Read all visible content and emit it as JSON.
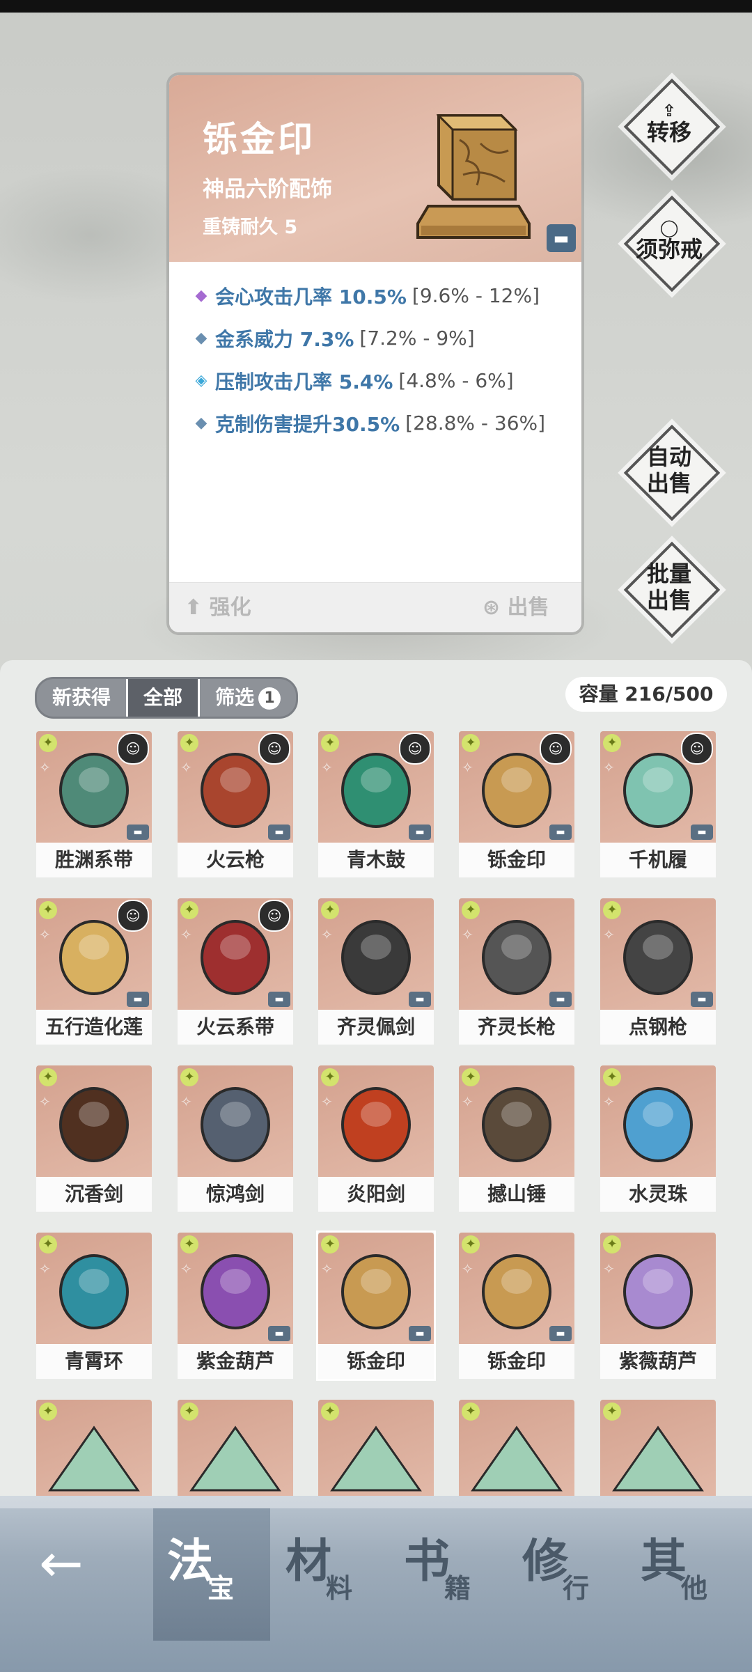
{
  "detail": {
    "name": "铄金印",
    "grade": "神品六阶配饰",
    "durability": "重铸耐久 5",
    "attributes": [
      {
        "marker": "◆",
        "marker_color": "#a56bd1",
        "name": "会心攻击几率 10.5%",
        "range": "[9.6% - 12%]"
      },
      {
        "marker": "◆",
        "marker_color": "#6a8fb0",
        "name": "金系威力 7.3%",
        "range": "[7.2% - 9%]"
      },
      {
        "marker": "◈",
        "marker_color": "#3aa7d8",
        "name": "压制攻击几率 5.4%",
        "range": "[4.8% - 6%]"
      },
      {
        "marker": "◆",
        "marker_color": "#6a8fb0",
        "name": "克制伤害提升30.5%",
        "range": "[28.8% - 36%]"
      }
    ],
    "enhance_label": "强化",
    "sell_label": "出售"
  },
  "side_buttons": {
    "transfer": "转移",
    "xumi_ring": "须弥戒",
    "auto_sell_1": "自动",
    "auto_sell_2": "出售",
    "batch_sell_1": "批量",
    "batch_sell_2": "出售"
  },
  "filters": {
    "new": "新获得",
    "all": "全部",
    "filter": "筛选",
    "filter_count": "1"
  },
  "capacity": "容量 216/500",
  "items": [
    {
      "name": "胜渊系带",
      "hero": true,
      "lock": true
    },
    {
      "name": "火云枪",
      "hero": true,
      "lock": true
    },
    {
      "name": "青木鼓",
      "hero": true,
      "lock": true
    },
    {
      "name": "铄金印",
      "hero": true,
      "lock": true
    },
    {
      "name": "千机履",
      "hero": true,
      "lock": true
    },
    {
      "name": "五行造化莲",
      "hero": true,
      "lock": true
    },
    {
      "name": "火云系带",
      "hero": true,
      "lock": true
    },
    {
      "name": "齐灵佩剑",
      "hero": false,
      "lock": true
    },
    {
      "name": "齐灵长枪",
      "hero": false,
      "lock": true
    },
    {
      "name": "点钢枪",
      "hero": false,
      "lock": true
    },
    {
      "name": "沉香剑",
      "hero": false,
      "lock": false
    },
    {
      "name": "惊鸿剑",
      "hero": false,
      "lock": false
    },
    {
      "name": "炎阳剑",
      "hero": false,
      "lock": false
    },
    {
      "name": "撼山锤",
      "hero": false,
      "lock": false
    },
    {
      "name": "水灵珠",
      "hero": false,
      "lock": false
    },
    {
      "name": "青霄环",
      "hero": false,
      "lock": false
    },
    {
      "name": "紫金葫芦",
      "hero": false,
      "lock": true
    },
    {
      "name": "铄金印",
      "hero": false,
      "lock": true
    },
    {
      "name": "铄金印",
      "hero": false,
      "lock": true
    },
    {
      "name": "紫薇葫芦",
      "hero": false,
      "lock": false
    }
  ],
  "nav": {
    "back": "←",
    "tabs": [
      {
        "big": "法",
        "small": "宝"
      },
      {
        "big": "材",
        "small": "料"
      },
      {
        "big": "书",
        "small": "籍"
      },
      {
        "big": "修",
        "small": "行"
      },
      {
        "big": "其",
        "small": "他"
      }
    ]
  },
  "colors": {
    "attr_name": "#3f77a8",
    "item_bg": "#d4a28f",
    "nav_bg": "#9eacba"
  }
}
